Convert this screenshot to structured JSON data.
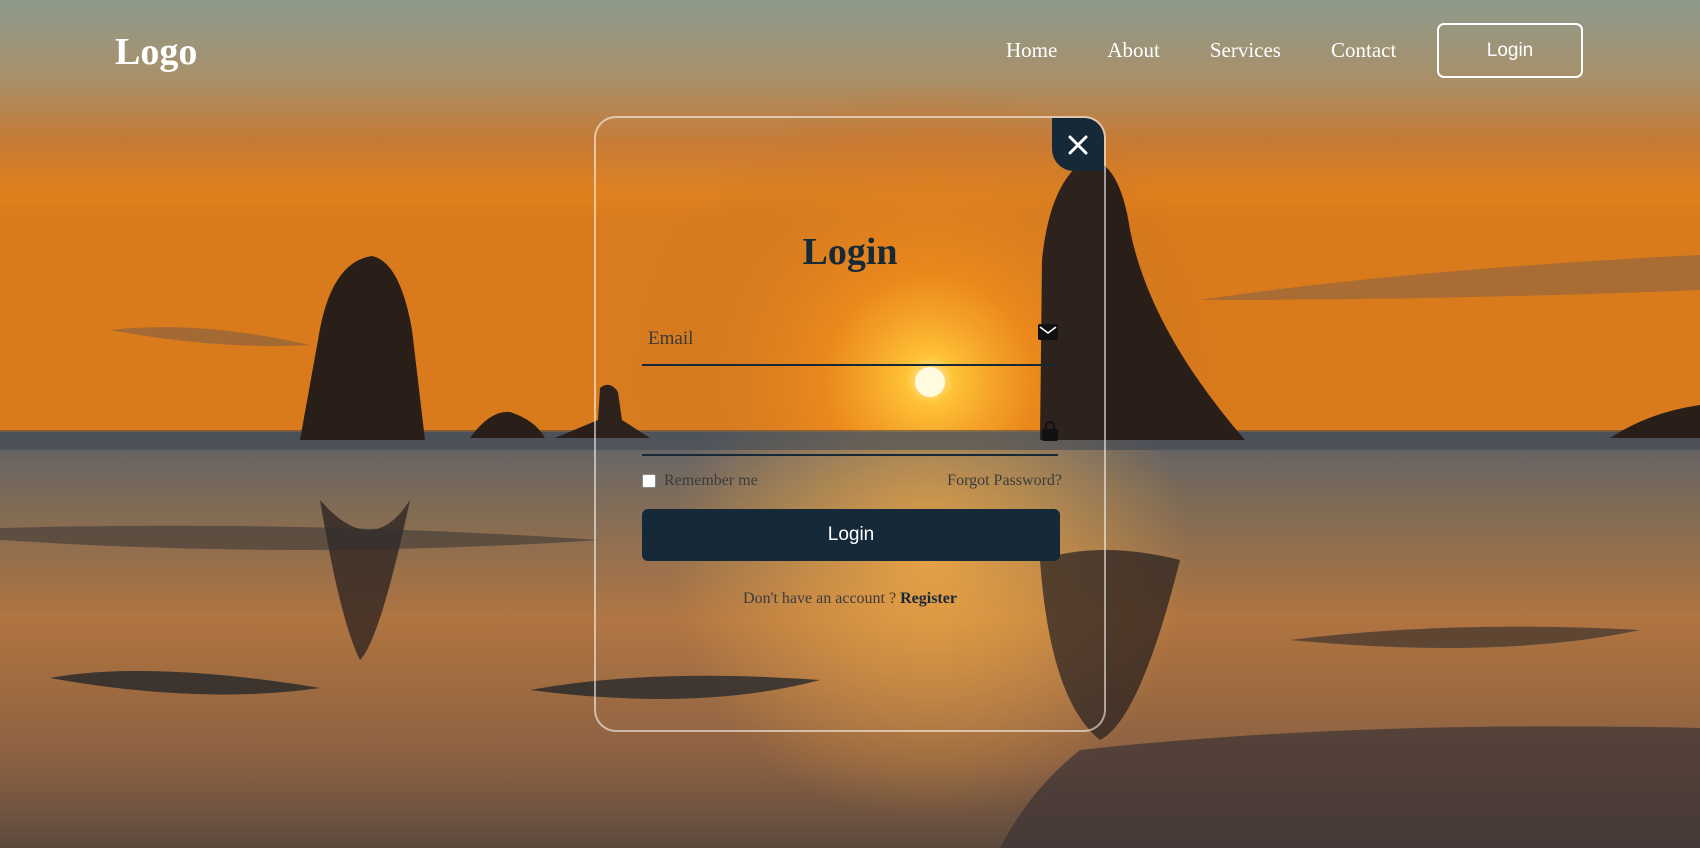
{
  "header": {
    "logo": "Logo",
    "nav": [
      "Home",
      "About",
      "Services",
      "Contact"
    ],
    "login_button": "Login"
  },
  "form": {
    "title": "Login",
    "email_label": "Email",
    "password_label": "",
    "remember_label": "Remember me",
    "forgot_label": "Forgot Password?",
    "submit_label": "Login",
    "register_prompt": "Don't have an account ?",
    "register_link": "Register"
  },
  "icons": {
    "close": "close-icon",
    "email": "mail-icon",
    "password": "lock-icon"
  },
  "colors": {
    "primary": "#162938",
    "text_light": "#ffffff"
  }
}
